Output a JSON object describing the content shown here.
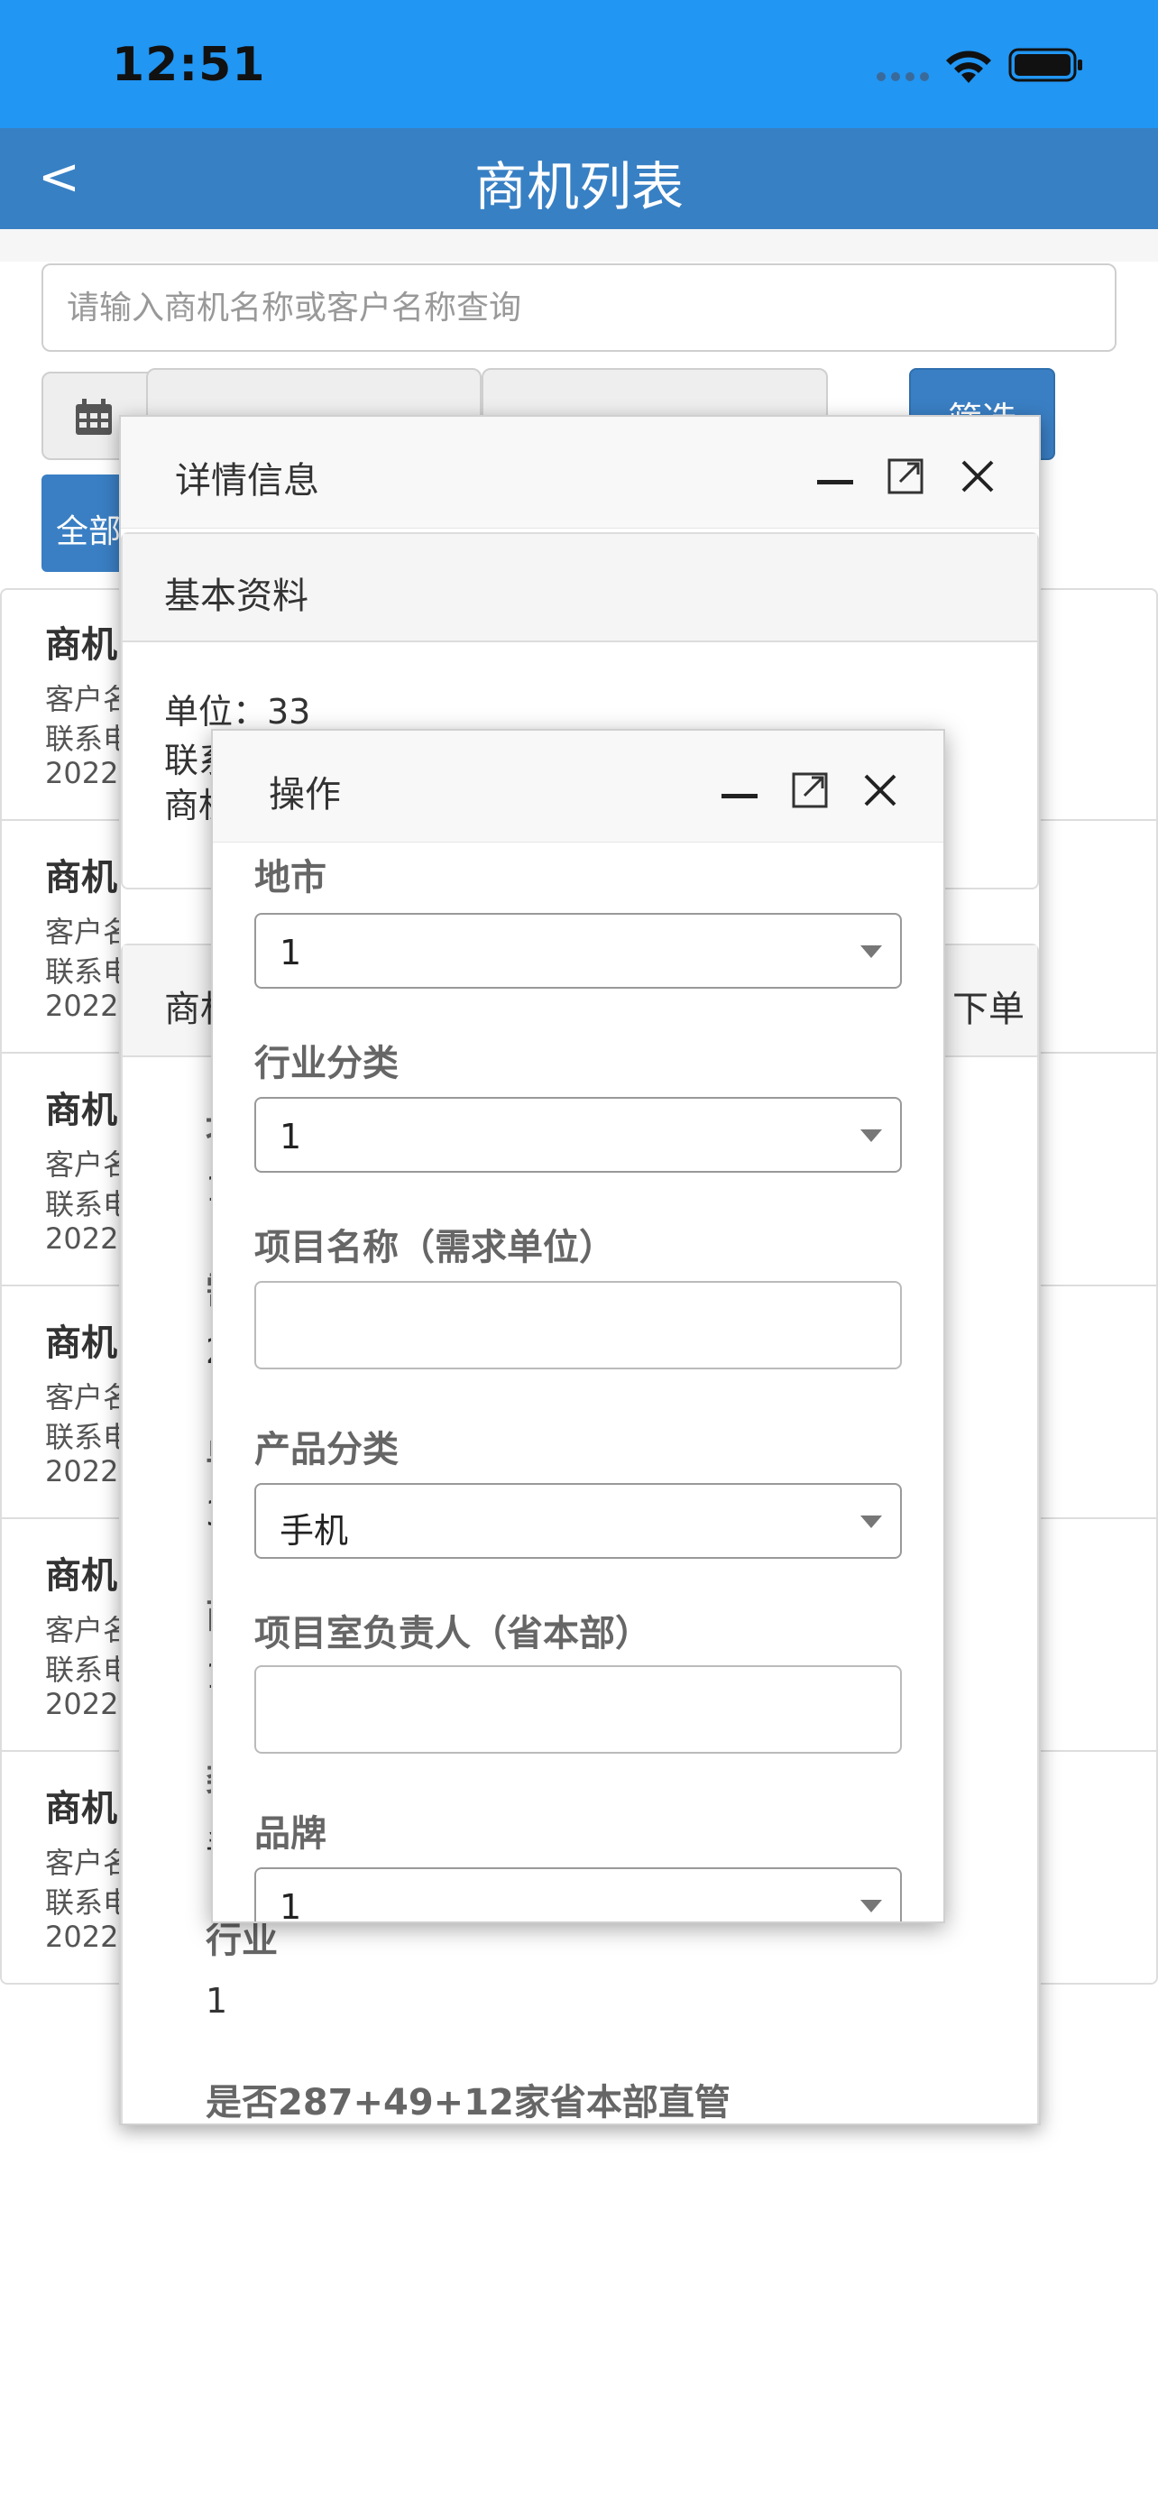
{
  "status_bar": {
    "time": "12:51"
  },
  "nav": {
    "back_label": "<",
    "title": "商机列表"
  },
  "search": {
    "placeholder": "请输入商机名称或客户名称查询"
  },
  "filter": {
    "button_label": "筛选",
    "all_label": "全部"
  },
  "list": {
    "items": [
      {
        "title": "商机",
        "line1": "客户名",
        "line2": "联系电",
        "line3": "2022-"
      },
      {
        "title": "商机",
        "line1": "客户名",
        "line2": "联系电",
        "line3": "2022-"
      },
      {
        "title": "商机",
        "line1": "客户名",
        "line2": "联系电",
        "line3": "2022-"
      },
      {
        "title": "商机",
        "line1": "客户名",
        "line2": "联系电",
        "line3": "2022-"
      },
      {
        "title": "商机",
        "line1": "客户名",
        "line2": "联系电",
        "line3": "2022-"
      },
      {
        "title": "商机",
        "line1": "客户名",
        "line2": "联系电",
        "line3": "2022-"
      }
    ]
  },
  "detail_dialog": {
    "title": "详情信息",
    "basic_panel": {
      "title": "基本资料",
      "unit": "单位：33",
      "contact": "联系",
      "opportunity": "商机"
    },
    "second_panel": {
      "title": "商机",
      "right_label": "下单",
      "fields": [
        {
          "label": "地",
          "value": "1"
        },
        {
          "label": "需",
          "value": "2"
        },
        {
          "label": "单",
          "value": "3"
        },
        {
          "label": "商",
          "value": "1"
        },
        {
          "label": "类",
          "value": "手"
        }
      ],
      "industry_label": "行业",
      "industry_value": "1",
      "direct_label": "是否287+49+12家省本部直管"
    }
  },
  "operation_dialog": {
    "title": "操作",
    "city_label": "地市",
    "city_value": "1",
    "industry_label": "行业分类",
    "industry_value": "1",
    "project_label": "项目名称（需求单位）",
    "project_value": "",
    "product_label": "产品分类",
    "product_value": "手机",
    "owner_label": "项目室负责人（省本部）",
    "owner_value": "",
    "brand_label": "品牌",
    "brand_value": "1"
  }
}
